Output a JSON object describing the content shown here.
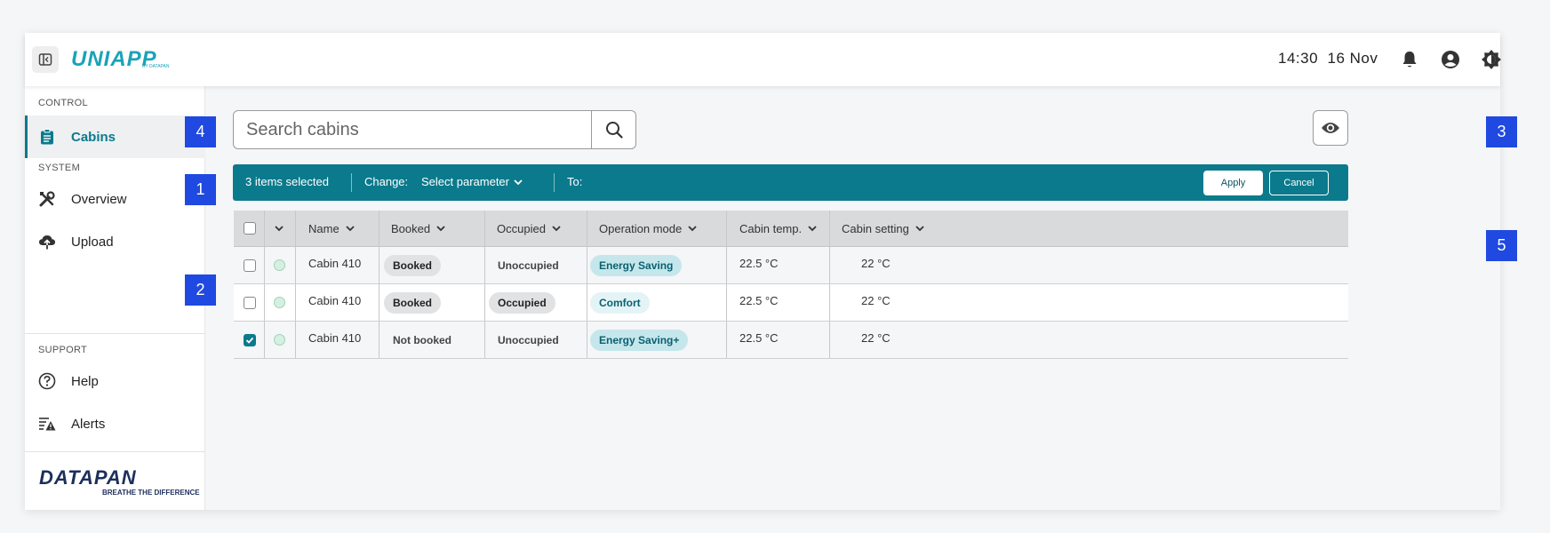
{
  "header": {
    "logo": "UNIAPP",
    "logo_sub": "BY DATAPAN",
    "time": "14:30",
    "date": "16 Nov"
  },
  "sidebar": {
    "sections": {
      "control": "CONTROL",
      "system": "SYSTEM",
      "support": "SUPPORT"
    },
    "items": [
      {
        "label": "Cabins",
        "icon": "clipboard-icon"
      },
      {
        "label": "Overview",
        "icon": "tools-icon"
      },
      {
        "label": "Upload",
        "icon": "cloud-upload-icon"
      },
      {
        "label": "Help",
        "icon": "help-icon"
      },
      {
        "label": "Alerts",
        "icon": "alerts-icon"
      }
    ],
    "brand": "DATAPAN",
    "brand_tagline": "BREATHE THE DIFFERENCE"
  },
  "search": {
    "placeholder": "Search cabins",
    "value": ""
  },
  "actionbar": {
    "selected": "3 items selected",
    "change_label": "Change:",
    "parameter": "Select parameter",
    "to_label": "To:",
    "apply": "Apply",
    "cancel": "Cancel"
  },
  "table": {
    "columns": [
      "Name",
      "Booked",
      "Occupied",
      "Operation mode",
      "Cabin temp.",
      "Cabin setting"
    ],
    "rows": [
      {
        "checked": false,
        "name": "Cabin 410",
        "booked": "Booked",
        "occupied": "Unoccupied",
        "mode": "Energy Saving",
        "temp": "22.5 °C",
        "setting": "22 °C"
      },
      {
        "checked": false,
        "name": "Cabin 410",
        "booked": "Booked",
        "occupied": "Occupied",
        "mode": "Comfort",
        "temp": "22.5 °C",
        "setting": "22 °C"
      },
      {
        "checked": true,
        "name": "Cabin 410",
        "booked": "Not booked",
        "occupied": "Unoccupied",
        "mode": "Energy Saving+",
        "temp": "22.5 °C",
        "setting": "22 °C"
      }
    ]
  },
  "callouts": [
    "1",
    "2",
    "3",
    "4",
    "5"
  ],
  "colors": {
    "accent": "#0b7a8c",
    "callout": "#1f49e0",
    "logo": "#1aa3b8",
    "brand": "#1d2f5c"
  }
}
